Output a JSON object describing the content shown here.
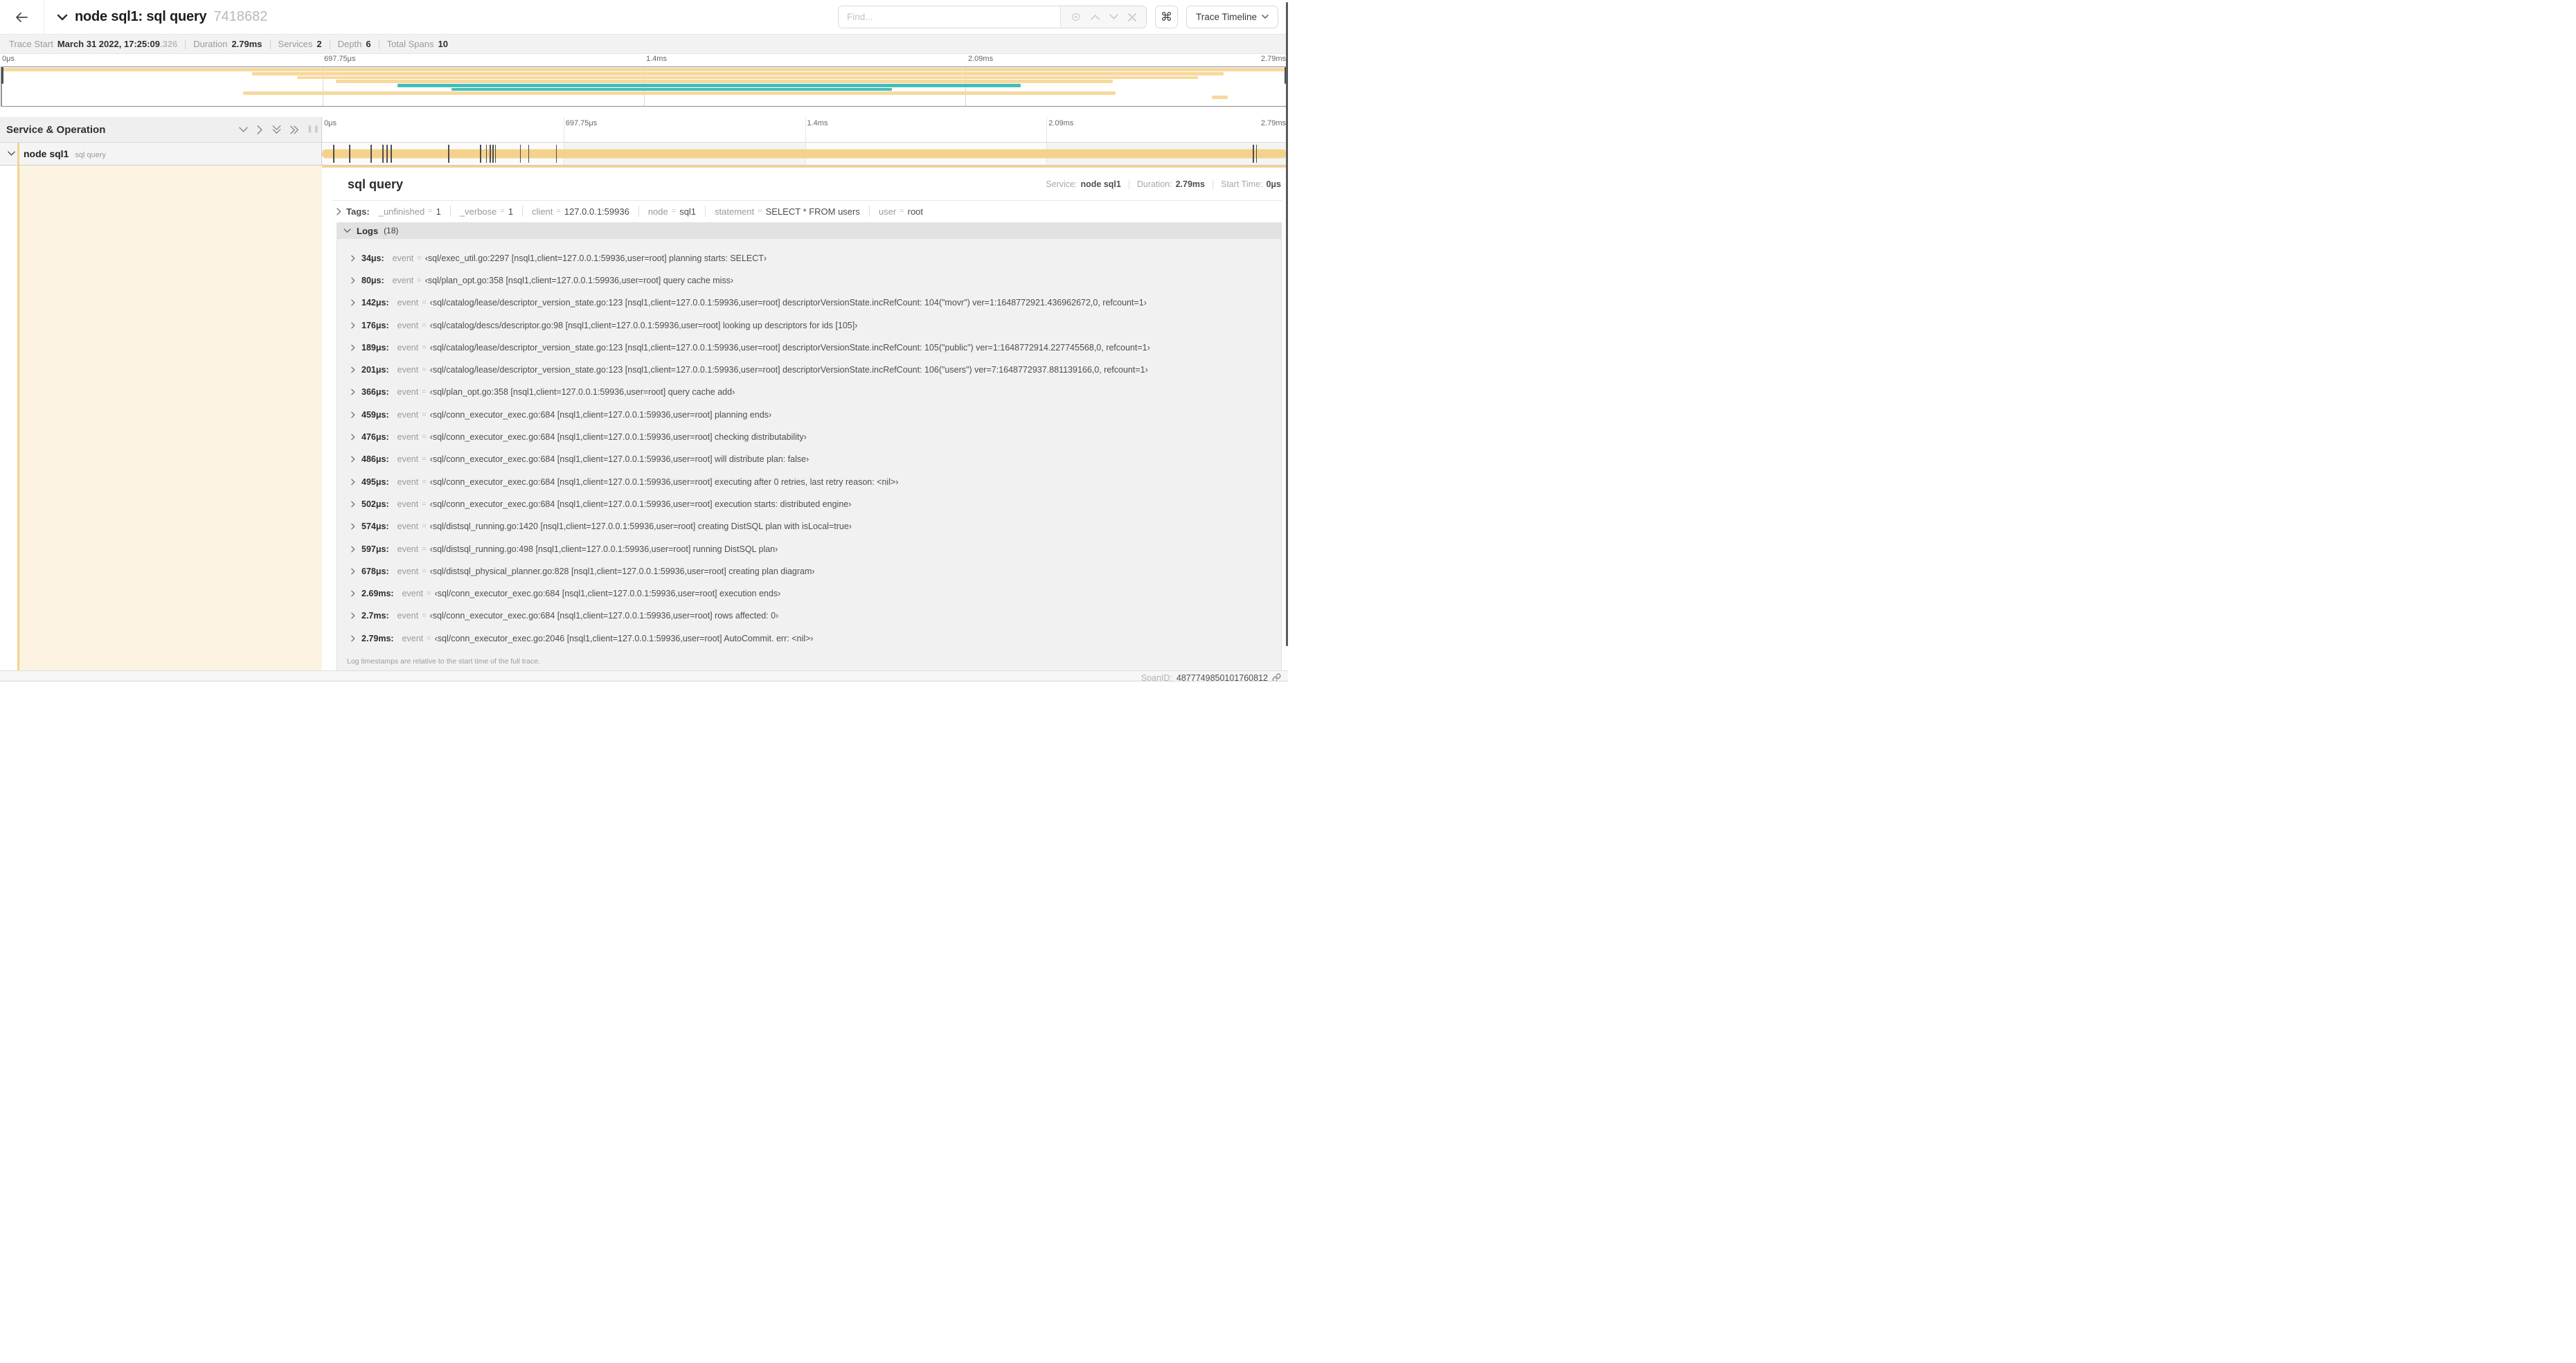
{
  "colors": {
    "tan": "#f5d28c",
    "tan_light": "#f7d99e",
    "teal": "#44bdb8",
    "cream": "#fcf3e2"
  },
  "header": {
    "title": "node sql1: sql query",
    "trace_id": "7418682",
    "find_placeholder": "Find...",
    "shortcut_key": "⌘",
    "view_button": "Trace Timeline"
  },
  "trace_info": [
    {
      "label": "Trace Start",
      "value": "March 31 2022, 17:25:09",
      "suffix": ".326"
    },
    {
      "label": "Duration",
      "value": "2.79ms",
      "suffix": ""
    },
    {
      "label": "Services",
      "value": "2",
      "suffix": ""
    },
    {
      "label": "Depth",
      "value": "6",
      "suffix": ""
    },
    {
      "label": "Total Spans",
      "value": "10",
      "suffix": ""
    }
  ],
  "ruler": {
    "ticks": [
      {
        "label": "0μs",
        "pct": 0,
        "align": "left"
      },
      {
        "label": "697.75μs",
        "pct": 25,
        "align": "left"
      },
      {
        "label": "1.4ms",
        "pct": 50,
        "align": "left"
      },
      {
        "label": "2.09ms",
        "pct": 75,
        "align": "left"
      },
      {
        "label": "2.79ms",
        "pct": 100,
        "align": "right"
      }
    ]
  },
  "minimap": {
    "spans": [
      {
        "row": 0,
        "start_pct": 0,
        "end_pct": 100,
        "color": "tan_light"
      },
      {
        "row": 1,
        "start_pct": 19.5,
        "end_pct": 95.1,
        "color": "tan_light"
      },
      {
        "row": 2,
        "start_pct": 23,
        "end_pct": 93.1,
        "color": "tan_light"
      },
      {
        "row": 3,
        "start_pct": 26,
        "end_pct": 86.5,
        "color": "tan_light"
      },
      {
        "row": 4,
        "start_pct": 30.8,
        "end_pct": 79.3,
        "color": "teal"
      },
      {
        "row": 5,
        "start_pct": 35,
        "end_pct": 69.3,
        "color": "teal"
      },
      {
        "row": 6,
        "start_pct": 18.8,
        "end_pct": 86.7,
        "color": "tan_light"
      },
      {
        "row": 7,
        "start_pct": 94.2,
        "end_pct": 95.4,
        "color": "tan_light"
      }
    ]
  },
  "timeline": {
    "left_header": "Service & Operation",
    "span": {
      "service": "node sql1",
      "operation": "sql query"
    },
    "log_marks": [
      {
        "pct": 1.22
      },
      {
        "pct": 2.87
      },
      {
        "pct": 5.09
      },
      {
        "pct": 6.31
      },
      {
        "pct": 6.77
      },
      {
        "pct": 7.2
      },
      {
        "pct": 13.12
      },
      {
        "pct": 16.45
      },
      {
        "pct": 17.06
      },
      {
        "pct": 17.42
      },
      {
        "pct": 17.74
      },
      {
        "pct": 17.99
      },
      {
        "pct": 20.57
      },
      {
        "pct": 21.4
      },
      {
        "pct": 24.3
      },
      {
        "pct": 96.42
      },
      {
        "pct": 96.77
      }
    ]
  },
  "detail": {
    "title": "sql query",
    "stats": [
      {
        "label": "Service:",
        "value": "node sql1"
      },
      {
        "label": "Duration:",
        "value": "2.79ms"
      },
      {
        "label": "Start Time:",
        "value": "0μs"
      }
    ],
    "tags_label": "Tags:",
    "tags": [
      {
        "key": "_unfinished",
        "value": "1"
      },
      {
        "key": "_verbose",
        "value": "1"
      },
      {
        "key": "client",
        "value": "127.0.0.1:59936"
      },
      {
        "key": "node",
        "value": "sql1"
      },
      {
        "key": "statement",
        "value": "SELECT * FROM users"
      },
      {
        "key": "user",
        "value": "root"
      }
    ],
    "logs": {
      "title": "Logs",
      "count": "(18)",
      "rows": [
        {
          "time": "34μs:",
          "key": "event",
          "value": "‹sql/exec_util.go:2297 [nsql1,client=127.0.0.1:59936,user=root] planning starts: SELECT›"
        },
        {
          "time": "80μs:",
          "key": "event",
          "value": "‹sql/plan_opt.go:358 [nsql1,client=127.0.0.1:59936,user=root] query cache miss›"
        },
        {
          "time": "142μs:",
          "key": "event",
          "value": "‹sql/catalog/lease/descriptor_version_state.go:123 [nsql1,client=127.0.0.1:59936,user=root] descriptorVersionState.incRefCount: 104(\"movr\") ver=1:1648772921.436962672,0, refcount=1›"
        },
        {
          "time": "176μs:",
          "key": "event",
          "value": "‹sql/catalog/descs/descriptor.go:98 [nsql1,client=127.0.0.1:59936,user=root] looking up descriptors for ids [105]›"
        },
        {
          "time": "189μs:",
          "key": "event",
          "value": "‹sql/catalog/lease/descriptor_version_state.go:123 [nsql1,client=127.0.0.1:59936,user=root] descriptorVersionState.incRefCount: 105(\"public\") ver=1:1648772914.227745568,0, refcount=1›"
        },
        {
          "time": "201μs:",
          "key": "event",
          "value": "‹sql/catalog/lease/descriptor_version_state.go:123 [nsql1,client=127.0.0.1:59936,user=root] descriptorVersionState.incRefCount: 106(\"users\") ver=7:1648772937.881139166,0, refcount=1›"
        },
        {
          "time": "366μs:",
          "key": "event",
          "value": "‹sql/plan_opt.go:358 [nsql1,client=127.0.0.1:59936,user=root] query cache add›"
        },
        {
          "time": "459μs:",
          "key": "event",
          "value": "‹sql/conn_executor_exec.go:684 [nsql1,client=127.0.0.1:59936,user=root] planning ends›"
        },
        {
          "time": "476μs:",
          "key": "event",
          "value": "‹sql/conn_executor_exec.go:684 [nsql1,client=127.0.0.1:59936,user=root] checking distributability›"
        },
        {
          "time": "486μs:",
          "key": "event",
          "value": "‹sql/conn_executor_exec.go:684 [nsql1,client=127.0.0.1:59936,user=root] will distribute plan: false›"
        },
        {
          "time": "495μs:",
          "key": "event",
          "value": "‹sql/conn_executor_exec.go:684 [nsql1,client=127.0.0.1:59936,user=root] executing after 0 retries, last retry reason: <nil>›"
        },
        {
          "time": "502μs:",
          "key": "event",
          "value": "‹sql/conn_executor_exec.go:684 [nsql1,client=127.0.0.1:59936,user=root] execution starts: distributed engine›"
        },
        {
          "time": "574μs:",
          "key": "event",
          "value": "‹sql/distsql_running.go:1420 [nsql1,client=127.0.0.1:59936,user=root] creating DistSQL plan with isLocal=true›"
        },
        {
          "time": "597μs:",
          "key": "event",
          "value": "‹sql/distsql_running.go:498 [nsql1,client=127.0.0.1:59936,user=root] running DistSQL plan›"
        },
        {
          "time": "678μs:",
          "key": "event",
          "value": "‹sql/distsql_physical_planner.go:828 [nsql1,client=127.0.0.1:59936,user=root] creating plan diagram›"
        },
        {
          "time": "2.69ms:",
          "key": "event",
          "value": "‹sql/conn_executor_exec.go:684 [nsql1,client=127.0.0.1:59936,user=root] execution ends›"
        },
        {
          "time": "2.7ms:",
          "key": "event",
          "value": "‹sql/conn_executor_exec.go:684 [nsql1,client=127.0.0.1:59936,user=root] rows affected: 0›"
        },
        {
          "time": "2.79ms:",
          "key": "event",
          "value": "‹sql/conn_executor_exec.go:2046 [nsql1,client=127.0.0.1:59936,user=root] AutoCommit. err: <nil>›"
        }
      ],
      "note": "Log timestamps are relative to the start time of the full trace."
    },
    "spanid_label": "SpanID:",
    "spanid_value": "4877749850101760812"
  }
}
